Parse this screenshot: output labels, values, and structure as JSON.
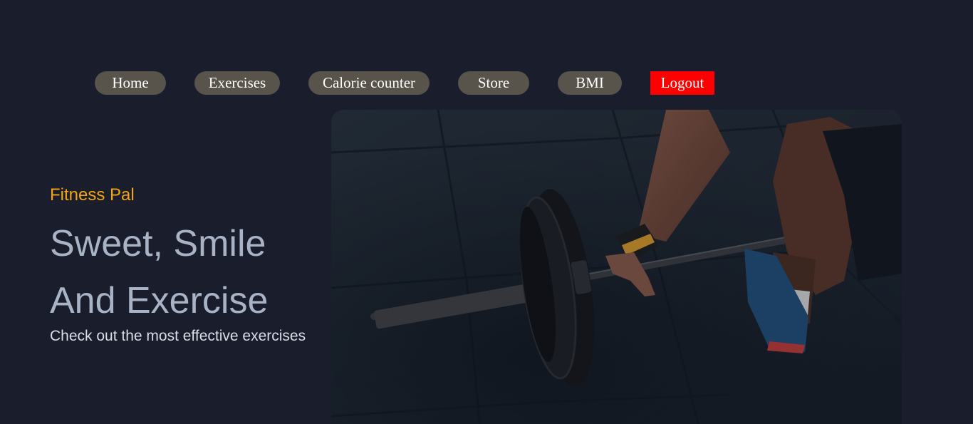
{
  "nav": {
    "items": [
      {
        "label": "Home"
      },
      {
        "label": "Exercises"
      },
      {
        "label": "Calorie counter"
      },
      {
        "label": "Store"
      },
      {
        "label": "BMI"
      }
    ],
    "logout_label": "Logout"
  },
  "hero": {
    "brand": "Fitness Pal",
    "headline_line1": "Sweet, Smile",
    "headline_line2": "And Exercise",
    "tagline": "Check out the most effective exercises",
    "image_icon": "barbell-deadlift-photo"
  },
  "colors": {
    "background": "#1a1d2b",
    "nav_pill": "#58534b",
    "logout": "#ff0000",
    "brand": "#f4a516",
    "headline": "#a9b3c6"
  }
}
